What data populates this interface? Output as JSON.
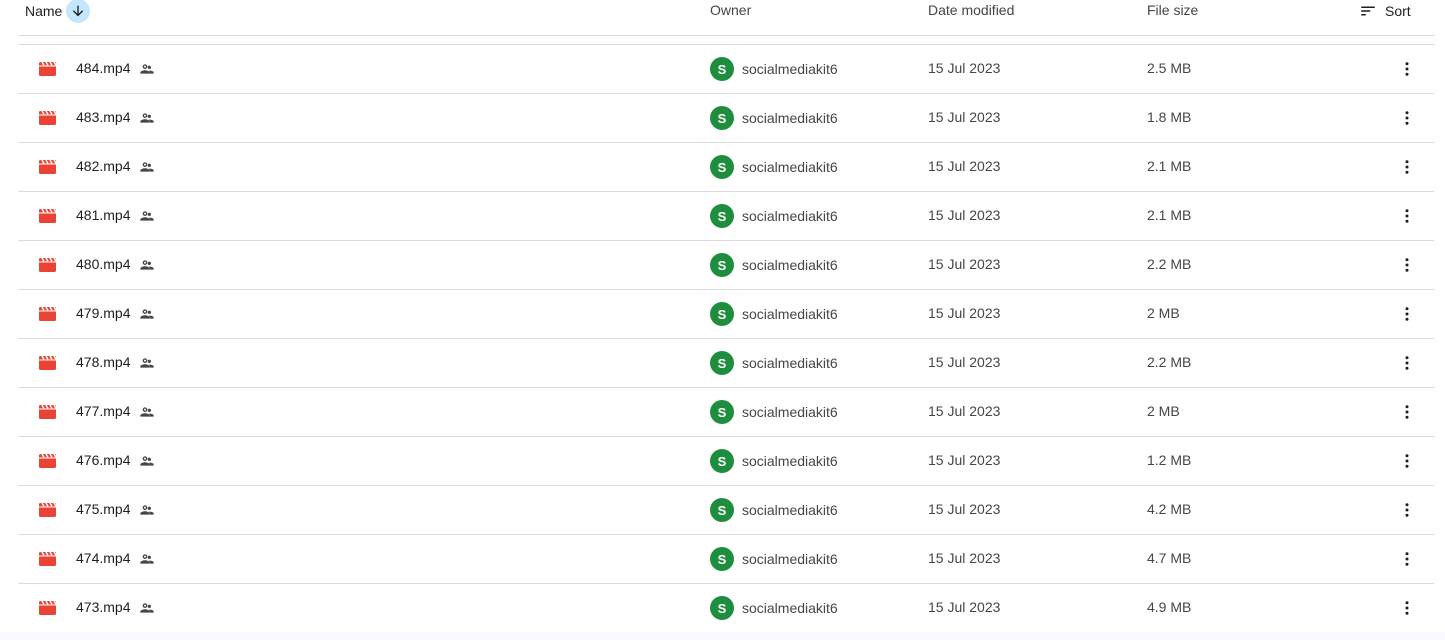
{
  "header": {
    "name_label": "Name",
    "owner_label": "Owner",
    "date_label": "Date modified",
    "size_label": "File size",
    "sort_label": "Sort",
    "sort_direction_icon": "arrow-down-icon"
  },
  "colors": {
    "file_icon": "#ea4335",
    "avatar_bg": "#1e8e3e",
    "sort_highlight": "#c2e7ff",
    "divider": "#dadce0"
  },
  "files": [
    {
      "name": "484.mp4",
      "owner_initial": "S",
      "owner": "socialmediakit6",
      "date": "15 Jul 2023",
      "size": "2.5 MB"
    },
    {
      "name": "483.mp4",
      "owner_initial": "S",
      "owner": "socialmediakit6",
      "date": "15 Jul 2023",
      "size": "1.8 MB"
    },
    {
      "name": "482.mp4",
      "owner_initial": "S",
      "owner": "socialmediakit6",
      "date": "15 Jul 2023",
      "size": "2.1 MB"
    },
    {
      "name": "481.mp4",
      "owner_initial": "S",
      "owner": "socialmediakit6",
      "date": "15 Jul 2023",
      "size": "2.1 MB"
    },
    {
      "name": "480.mp4",
      "owner_initial": "S",
      "owner": "socialmediakit6",
      "date": "15 Jul 2023",
      "size": "2.2 MB"
    },
    {
      "name": "479.mp4",
      "owner_initial": "S",
      "owner": "socialmediakit6",
      "date": "15 Jul 2023",
      "size": "2 MB"
    },
    {
      "name": "478.mp4",
      "owner_initial": "S",
      "owner": "socialmediakit6",
      "date": "15 Jul 2023",
      "size": "2.2 MB"
    },
    {
      "name": "477.mp4",
      "owner_initial": "S",
      "owner": "socialmediakit6",
      "date": "15 Jul 2023",
      "size": "2 MB"
    },
    {
      "name": "476.mp4",
      "owner_initial": "S",
      "owner": "socialmediakit6",
      "date": "15 Jul 2023",
      "size": "1.2 MB"
    },
    {
      "name": "475.mp4",
      "owner_initial": "S",
      "owner": "socialmediakit6",
      "date": "15 Jul 2023",
      "size": "4.2 MB"
    },
    {
      "name": "474.mp4",
      "owner_initial": "S",
      "owner": "socialmediakit6",
      "date": "15 Jul 2023",
      "size": "4.7 MB"
    },
    {
      "name": "473.mp4",
      "owner_initial": "S",
      "owner": "socialmediakit6",
      "date": "15 Jul 2023",
      "size": "4.9 MB"
    }
  ]
}
